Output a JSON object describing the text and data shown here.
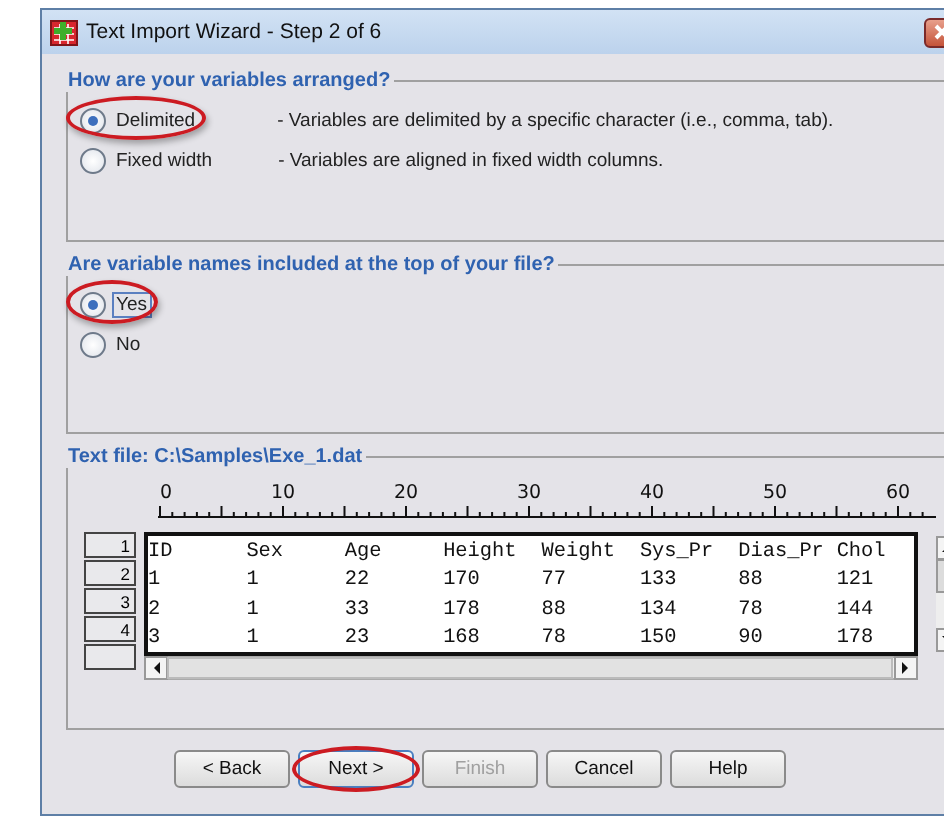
{
  "window": {
    "title": "Text Import Wizard - Step 2 of 6"
  },
  "arrangement": {
    "legend": "How are your variables arranged?",
    "options": [
      {
        "label": "Delimited",
        "description": "- Variables are delimited by a specific character (i.e., comma, tab).",
        "selected": true,
        "circled": true
      },
      {
        "label": "Fixed width",
        "description": "- Variables are aligned in fixed width columns.",
        "selected": false,
        "circled": false
      }
    ]
  },
  "names_at_top": {
    "legend": "Are variable names included at the top of your file?",
    "options": [
      {
        "label": "Yes",
        "selected": true,
        "circled": true,
        "focused": true
      },
      {
        "label": "No",
        "selected": false,
        "circled": false,
        "focused": false
      }
    ]
  },
  "preview": {
    "legend": "Text file:  C:\\Samples\\Exe_1.dat",
    "ruler_labels": [
      "0",
      "10",
      "20",
      "30",
      "40",
      "50",
      "60"
    ],
    "rows": [
      {
        "number": "1",
        "cells": [
          "ID",
          "Sex",
          "Age",
          "Height",
          "Weight",
          "Sys_Pr",
          "Dias_Pr",
          "Chol"
        ]
      },
      {
        "number": "2",
        "cells": [
          "1",
          "1",
          "22",
          "170",
          "77",
          "133",
          "88",
          "121"
        ]
      },
      {
        "number": "3",
        "cells": [
          "2",
          "1",
          "33",
          "178",
          "88",
          "134",
          "78",
          "144"
        ]
      },
      {
        "number": "4",
        "cells": [
          "3",
          "1",
          "23",
          "168",
          "78",
          "150",
          "90",
          "178"
        ]
      }
    ]
  },
  "buttons": [
    {
      "label": "< Back",
      "disabled": false,
      "circled": false,
      "default": false
    },
    {
      "label": "Next >",
      "disabled": false,
      "circled": true,
      "default": true
    },
    {
      "label": "Finish",
      "disabled": true,
      "circled": false,
      "default": false
    },
    {
      "label": "Cancel",
      "disabled": false,
      "circled": false,
      "default": false
    },
    {
      "label": "Help",
      "disabled": false,
      "circled": false,
      "default": false
    }
  ]
}
